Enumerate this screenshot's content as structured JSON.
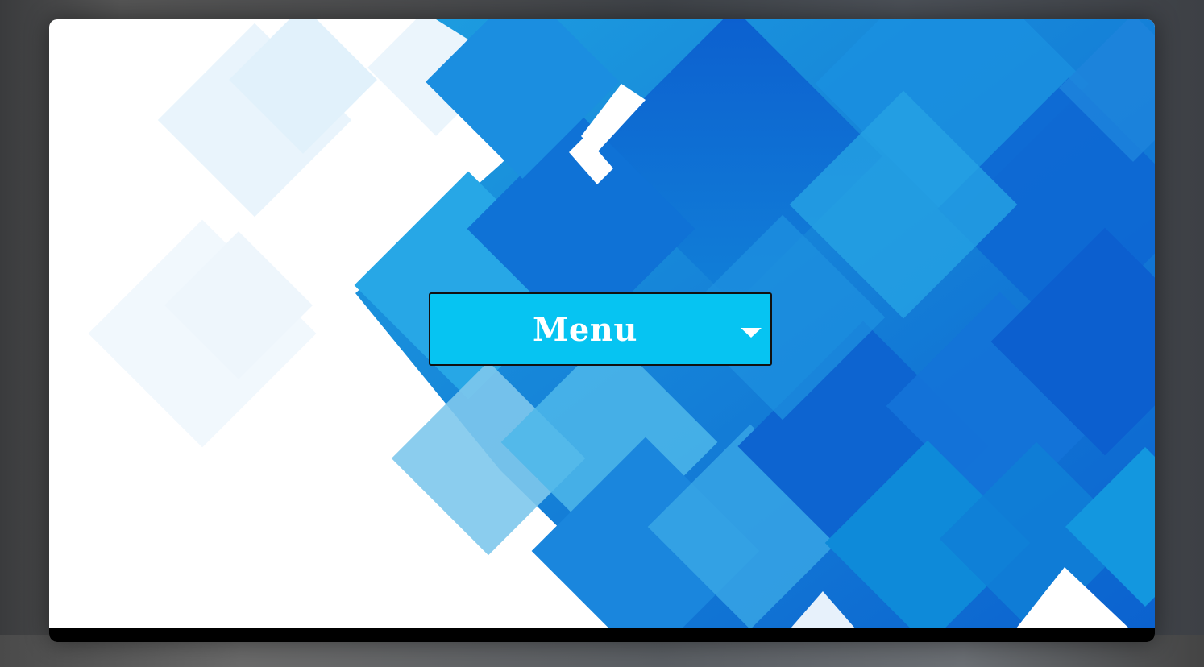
{
  "menu": {
    "label": "Menu",
    "caret_icon": "caret-down-icon",
    "background_color": "#06c4f2",
    "text_color": "#ffffff"
  },
  "theme": {
    "background_art": "blue-diamond-tiles",
    "primary_blue": "#0a6ed6",
    "light_blue": "#29abe2"
  }
}
